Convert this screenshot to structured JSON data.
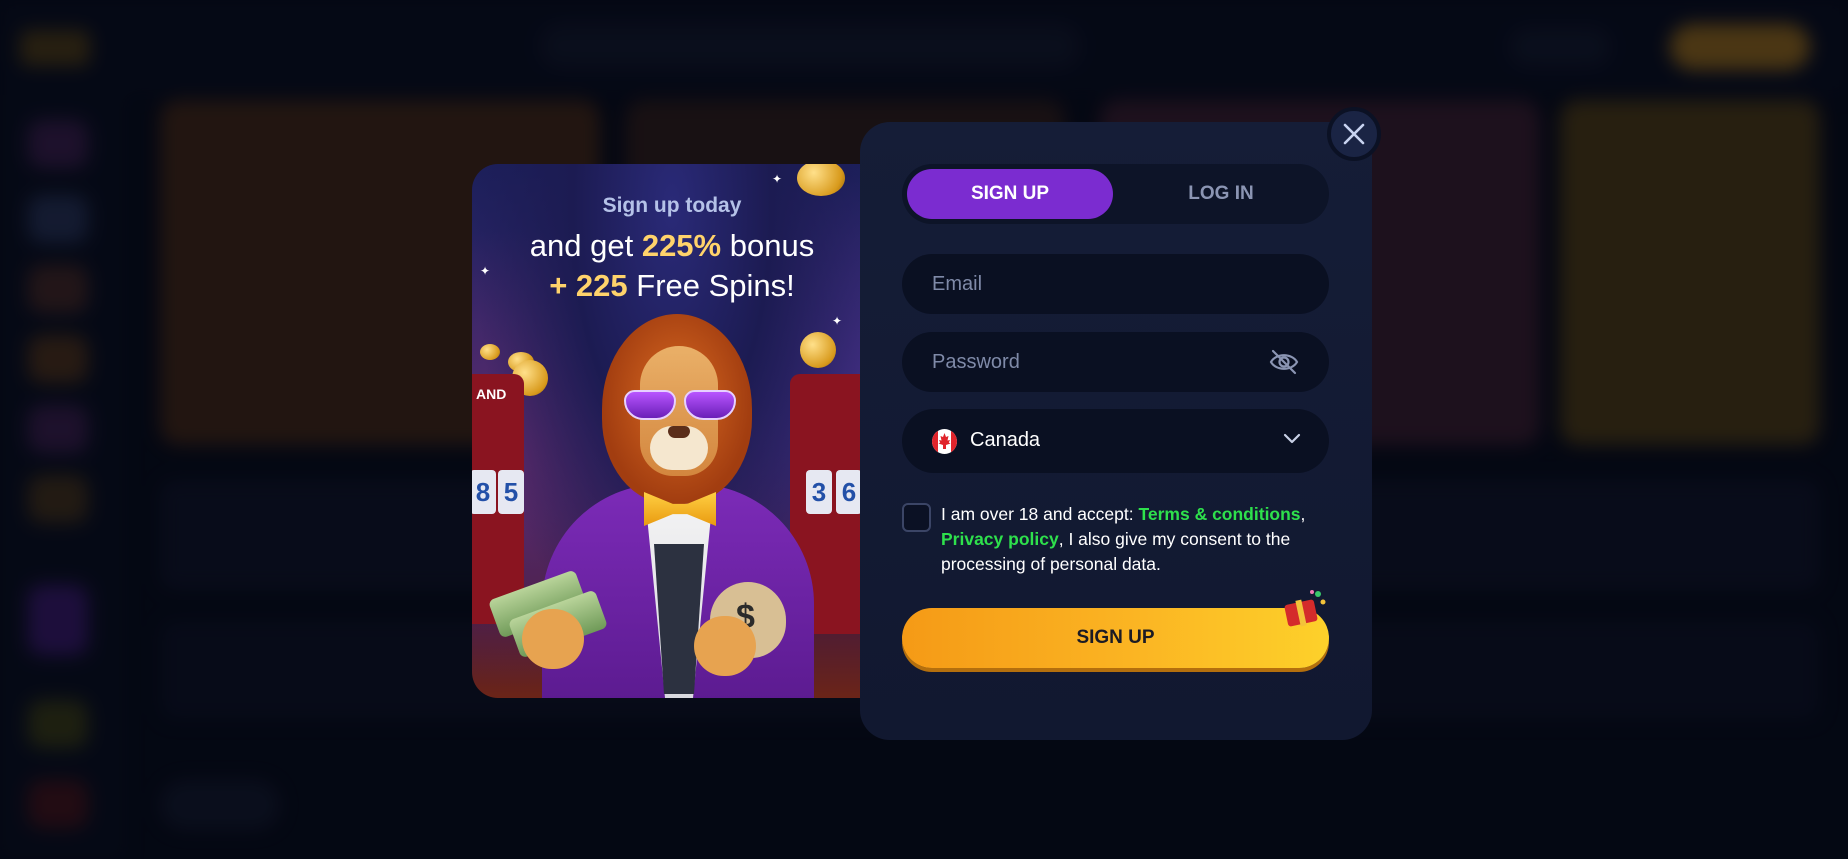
{
  "promo": {
    "subtitle": "Sign up today",
    "line1_prefix": "and get ",
    "line1_highlight": "225%",
    "line1_suffix": " bonus",
    "line2_highlight": "+ 225",
    "line2_suffix": " Free Spins!",
    "slot_left_digits": [
      "8",
      "5"
    ],
    "slot_right_digits": [
      "3",
      "6"
    ],
    "slot_left_sign": "AND",
    "highlight_color": "#ffd36b"
  },
  "tabs": {
    "signup_label": "SIGN UP",
    "login_label": "LOG IN",
    "active": "signup",
    "active_color": "#7b2cd0"
  },
  "form": {
    "email_placeholder": "Email",
    "email_value": "",
    "password_placeholder": "Password",
    "password_value": "",
    "password_visibility_icon": "eye-off-icon",
    "country_label": "Canada",
    "country_flag": "canada-flag-icon",
    "consent_checked": false,
    "consent_prefix": "I am over 18 and accept: ",
    "terms_link": "Terms & conditions",
    "comma": ",",
    "privacy_link": "Privacy policy",
    "consent_suffix": ", I also give my consent to the processing of personal data.",
    "link_color": "#2ee04c",
    "submit_label": "SIGN UP",
    "submit_color": "#fbb523"
  },
  "close_icon": "close-icon"
}
